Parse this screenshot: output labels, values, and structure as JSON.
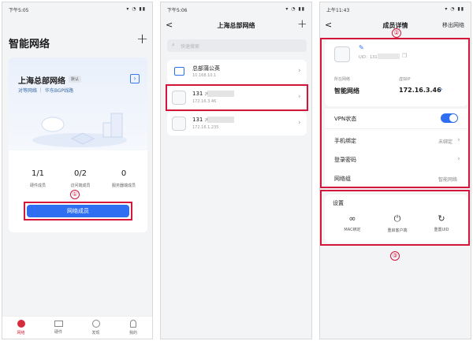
{
  "panel1": {
    "status_time": "下午5:05",
    "status_icons": "▾ ◔ ▮▮",
    "title": "智能网络",
    "add_label": "+",
    "network_name": "上海总部网络",
    "default_badge": "默认",
    "network_desc": "对等网络 ｜ 华东BGP线路",
    "stats": [
      {
        "value": "1/1",
        "label": "硬件成员"
      },
      {
        "value": "0/2",
        "label": "访问端成员"
      },
      {
        "value": "0",
        "label": "服务器端成员"
      }
    ],
    "members_button": "网络成员",
    "callout": "①",
    "nav": [
      {
        "label": "网络",
        "icon": "network-icon"
      },
      {
        "label": "硬件",
        "icon": "router-icon"
      },
      {
        "label": "发现",
        "icon": "compass-icon"
      },
      {
        "label": "我的",
        "icon": "person-icon"
      }
    ],
    "colors": {
      "accent": "#2f6ef0",
      "callout": "#d4163a"
    }
  },
  "panel2": {
    "status_time": "下午5:06",
    "status_icons": "▾ ◔ ▮▮",
    "title": "上海总部网络",
    "back_label": "<",
    "add_label": "+",
    "search_placeholder": "快速搜索",
    "items": [
      {
        "name": "总部蒲公英",
        "ip": "10.168.10.1",
        "icon": "router-icon"
      },
      {
        "name": "131 :004",
        "ip": "172.16.3.46",
        "icon": "user-icon"
      },
      {
        "name": "131 :005",
        "ip": "172.16.1.235",
        "icon": "user-icon"
      }
    ]
  },
  "panel3": {
    "status_time": "上午11:43",
    "status_icons": "▾ ◔ ▮▮",
    "title": "成员详情",
    "back_label": "<",
    "remove_label": "移出网络",
    "uid_label": "UID：131",
    "network_label": "所在网络",
    "network_value": "智能网络",
    "vip_label": "虚拟IP",
    "vip_value": "172.16.3.46",
    "vpn_label": "VPN状态",
    "vpn_on": true,
    "phone_label": "手机绑定",
    "phone_value": "未绑定",
    "password_label": "登录密码",
    "group_label": "网络组",
    "group_value": "智能网络",
    "settings_title": "设置",
    "actions": [
      {
        "label": "MAC绑定",
        "icon": "link-icon"
      },
      {
        "label": "重启客户端",
        "icon": "power-icon"
      },
      {
        "label": "重置UID",
        "icon": "reset-icon"
      }
    ],
    "callout2": "②",
    "callout3": "③"
  }
}
